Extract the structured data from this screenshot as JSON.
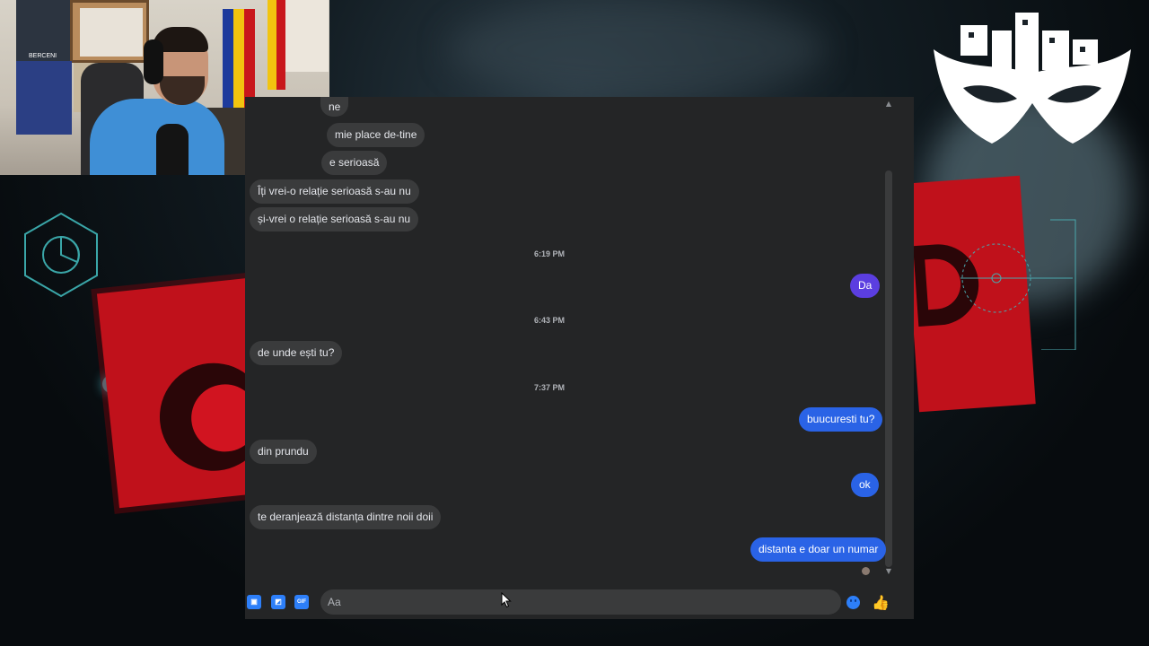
{
  "webcam": {
    "poster_text": "BERCENI"
  },
  "messages": [
    {
      "dir": "in",
      "text": "ne"
    },
    {
      "dir": "in",
      "text": "mie place de-tine"
    },
    {
      "dir": "in",
      "text": "e serioasă"
    },
    {
      "dir": "in",
      "text": "Îți vrei-o relație serioasă  s-au nu"
    },
    {
      "dir": "in",
      "text": "și-vrei o relație serioasă s-au nu"
    },
    {
      "dir": "ts",
      "text": "6:19 PM"
    },
    {
      "dir": "out",
      "text": "Da"
    },
    {
      "dir": "ts",
      "text": "6:43 PM"
    },
    {
      "dir": "in",
      "text": "de unde ești tu?"
    },
    {
      "dir": "ts",
      "text": "7:37 PM"
    },
    {
      "dir": "out",
      "text": "buucuresti tu?"
    },
    {
      "dir": "in",
      "text": "din prundu"
    },
    {
      "dir": "out",
      "text": "ok"
    },
    {
      "dir": "in",
      "text": "te deranjează distanța  dintre noii doii"
    },
    {
      "dir": "out",
      "text": "distanta e doar un numar"
    }
  ],
  "composer": {
    "placeholder": "Aa",
    "gif_label": "GIF",
    "like_icon": "👍"
  },
  "icons": {
    "attach": "photo-attach-icon",
    "sticker": "sticker-icon",
    "gif": "gif-icon",
    "emoji": "emoji-icon",
    "like": "thumbs-up-icon"
  },
  "colors": {
    "panel_bg": "#242526",
    "incoming_bubble": "#3a3b3c",
    "outgoing_bubble": "#2f5ad8",
    "accent": "#2d7ff9"
  }
}
